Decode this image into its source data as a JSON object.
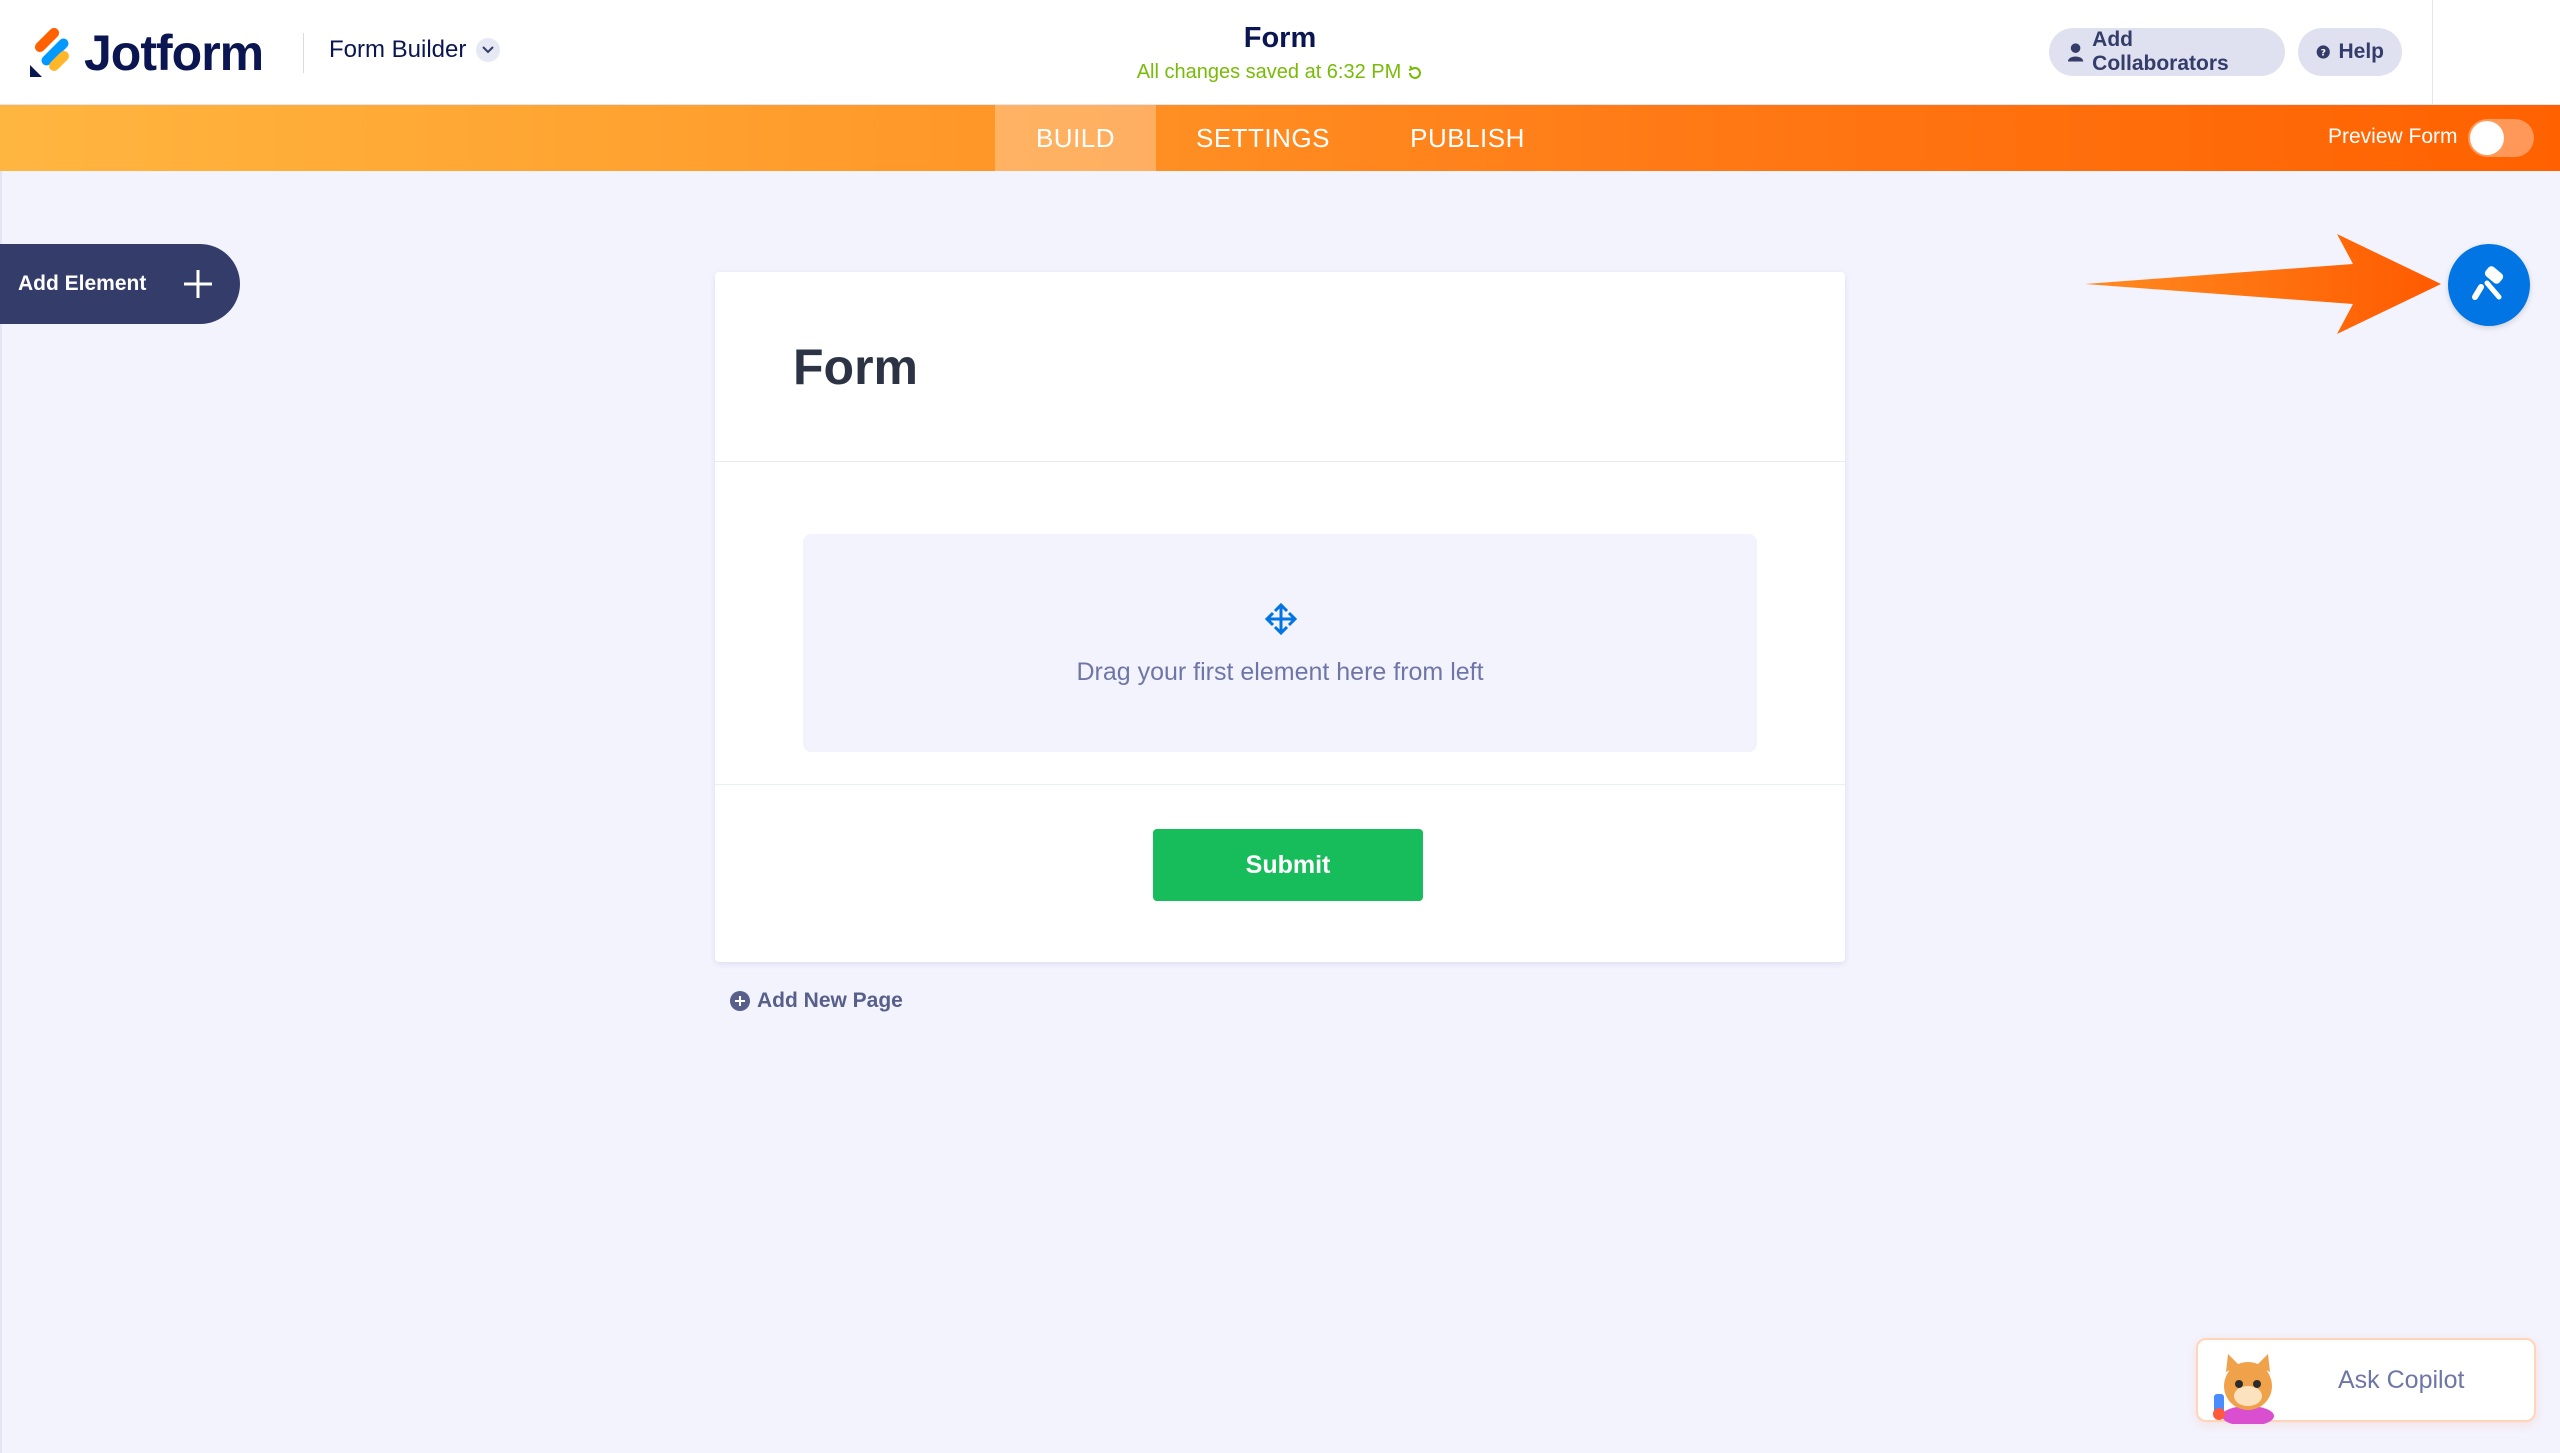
{
  "header": {
    "brand": "Jotform",
    "builder_switch": "Form Builder",
    "form_title": "Form",
    "save_status": "All changes saved at 6:32 PM",
    "collaborators_label": "Add Collaborators",
    "help_label": "Help"
  },
  "nav": {
    "tabs": [
      {
        "label": "BUILD",
        "active": true
      },
      {
        "label": "SETTINGS",
        "active": false
      },
      {
        "label": "PUBLISH",
        "active": false
      }
    ],
    "preview_label": "Preview Form",
    "preview_on": false
  },
  "sidebar": {
    "add_element_label": "Add Element"
  },
  "form": {
    "title": "Form",
    "dropzone_text": "Drag your first element here from left",
    "submit_label": "Submit",
    "add_page_label": "Add New Page"
  },
  "copilot": {
    "label": "Ask Copilot"
  },
  "colors": {
    "accent_orange": "#ff6100",
    "designer_blue": "#0075e3",
    "submit_green": "#18bd5b",
    "saved_green": "#78bb07"
  },
  "icons": [
    "jotform-logo-icon",
    "chevron-down-icon",
    "refresh-icon",
    "user-icon",
    "help-icon",
    "plus-icon",
    "move-icon",
    "add-circle-icon",
    "paint-roller-icon",
    "arrow-annotation-icon",
    "copilot-avatar-icon"
  ]
}
